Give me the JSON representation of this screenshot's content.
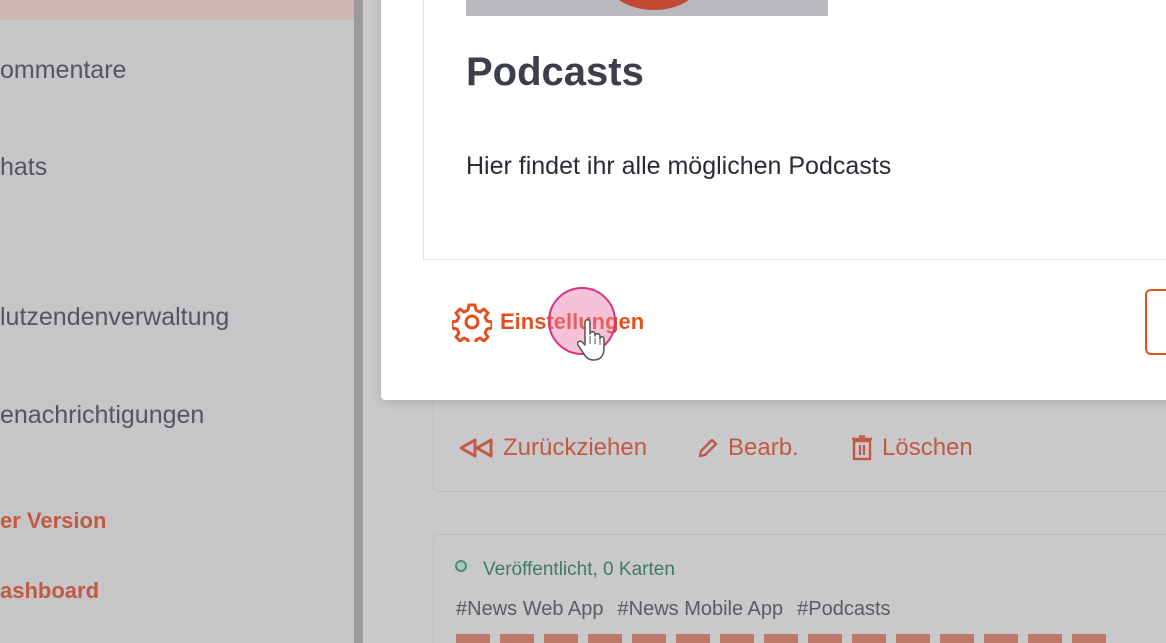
{
  "sidebar": {
    "items": [
      {
        "label": "ommentare"
      },
      {
        "label": "hats"
      },
      {
        "label": "lutzendenverwaltung"
      },
      {
        "label": "enachrichtigungen"
      }
    ],
    "links": [
      {
        "label": "er Version"
      },
      {
        "label": "ashboard"
      }
    ]
  },
  "modal": {
    "title": "Podcasts",
    "description": "Hier findet ihr alle möglichen Podcasts",
    "settings_label": "Einstellungen",
    "settings_icon": "gear-icon"
  },
  "background_card": {
    "actions": [
      {
        "label": "Zurückziehen",
        "icon": "withdraw-icon"
      },
      {
        "label": "Bearb.",
        "icon": "pencil-icon"
      },
      {
        "label": "Löschen",
        "icon": "trash-icon"
      }
    ]
  },
  "background_card2": {
    "status": "Veröffentlicht, 0 Karten",
    "tags": [
      "#News Web App",
      "#News Mobile App",
      "#Podcasts"
    ]
  },
  "colors": {
    "accent": "#e3501f",
    "status_green": "#3f7a65",
    "title_dark": "#3c3e4b"
  }
}
